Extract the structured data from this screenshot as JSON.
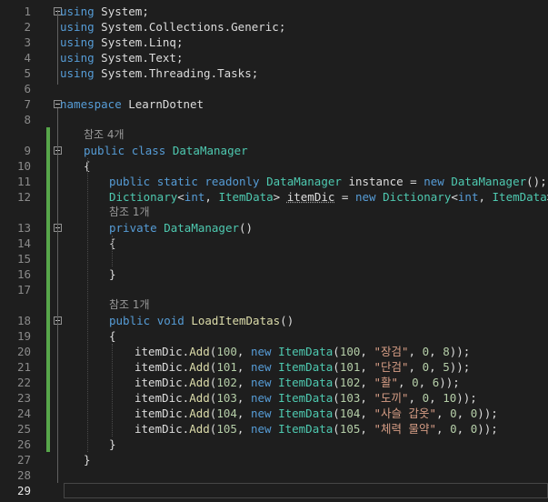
{
  "editor": {
    "current_line": 29,
    "lines": [
      {
        "num": "1",
        "indent": 0,
        "fold": true,
        "tokens": [
          {
            "c": "k",
            "t": "using"
          },
          {
            "c": "p",
            "t": " System;"
          }
        ]
      },
      {
        "num": "2",
        "indent": 0,
        "tokens": [
          {
            "c": "k",
            "t": "using"
          },
          {
            "c": "p",
            "t": " System.Collections.Generic;"
          }
        ]
      },
      {
        "num": "3",
        "indent": 0,
        "tokens": [
          {
            "c": "k",
            "t": "using"
          },
          {
            "c": "p",
            "t": " System.Linq;"
          }
        ]
      },
      {
        "num": "4",
        "indent": 0,
        "tokens": [
          {
            "c": "k",
            "t": "using"
          },
          {
            "c": "p",
            "t": " System.Text;"
          }
        ]
      },
      {
        "num": "5",
        "indent": 0,
        "tokens": [
          {
            "c": "k",
            "t": "using"
          },
          {
            "c": "p",
            "t": " System.Threading.Tasks;"
          }
        ]
      },
      {
        "num": "6",
        "indent": 0,
        "tokens": []
      },
      {
        "num": "7",
        "indent": 0,
        "fold": true,
        "tokens": [
          {
            "c": "k",
            "t": "namespace"
          },
          {
            "c": "p",
            "t": " LearnDotnet"
          }
        ]
      },
      {
        "num": "8",
        "indent": 0,
        "tokens": []
      },
      {
        "lens": "참조 4개",
        "indent": 1
      },
      {
        "num": "9",
        "indent": 1,
        "fold": true,
        "tokens": [
          {
            "c": "k",
            "t": "public"
          },
          {
            "c": "p",
            "t": " "
          },
          {
            "c": "k",
            "t": "class"
          },
          {
            "c": "p",
            "t": " "
          },
          {
            "c": "t",
            "t": "DataManager"
          }
        ]
      },
      {
        "num": "10",
        "indent": 1,
        "tokens": [
          {
            "c": "p",
            "t": "{"
          }
        ]
      },
      {
        "num": "11",
        "indent": 2,
        "tokens": [
          {
            "c": "k",
            "t": "public"
          },
          {
            "c": "p",
            "t": " "
          },
          {
            "c": "k",
            "t": "static"
          },
          {
            "c": "p",
            "t": " "
          },
          {
            "c": "k",
            "t": "readonly"
          },
          {
            "c": "p",
            "t": " "
          },
          {
            "c": "t",
            "t": "DataManager"
          },
          {
            "c": "p",
            "t": " instance = "
          },
          {
            "c": "k",
            "t": "new"
          },
          {
            "c": "p",
            "t": " "
          },
          {
            "c": "t",
            "t": "DataManager"
          },
          {
            "c": "p",
            "t": "();"
          }
        ]
      },
      {
        "num": "12",
        "indent": 2,
        "tokens": [
          {
            "c": "t",
            "t": "Dictionary"
          },
          {
            "c": "p",
            "t": "<"
          },
          {
            "c": "k",
            "t": "int"
          },
          {
            "c": "p",
            "t": ", "
          },
          {
            "c": "t",
            "t": "ItemData"
          },
          {
            "c": "p",
            "t": "> "
          },
          {
            "c": "v squiggle",
            "t": "itemDic"
          },
          {
            "c": "p",
            "t": " = "
          },
          {
            "c": "k",
            "t": "new"
          },
          {
            "c": "p",
            "t": " "
          },
          {
            "c": "t",
            "t": "Dictionary"
          },
          {
            "c": "p",
            "t": "<"
          },
          {
            "c": "k",
            "t": "int"
          },
          {
            "c": "p",
            "t": ", "
          },
          {
            "c": "t",
            "t": "ItemData"
          },
          {
            "c": "p",
            "t": ">();"
          }
        ]
      },
      {
        "lens": "참조 1개",
        "indent": 2
      },
      {
        "num": "13",
        "indent": 2,
        "fold": true,
        "tokens": [
          {
            "c": "k",
            "t": "private"
          },
          {
            "c": "p",
            "t": " "
          },
          {
            "c": "t",
            "t": "DataManager"
          },
          {
            "c": "p",
            "t": "()"
          }
        ]
      },
      {
        "num": "14",
        "indent": 2,
        "tokens": [
          {
            "c": "p",
            "t": "{"
          }
        ]
      },
      {
        "num": "15",
        "indent": 2,
        "tokens": []
      },
      {
        "num": "16",
        "indent": 2,
        "tokens": [
          {
            "c": "p",
            "t": "}"
          }
        ]
      },
      {
        "num": "17",
        "indent": 2,
        "tokens": []
      },
      {
        "lens": "참조 1개",
        "indent": 2
      },
      {
        "num": "18",
        "indent": 2,
        "fold": true,
        "tokens": [
          {
            "c": "k",
            "t": "public"
          },
          {
            "c": "p",
            "t": " "
          },
          {
            "c": "k",
            "t": "void"
          },
          {
            "c": "p",
            "t": " "
          },
          {
            "c": "m",
            "t": "LoadItemDatas"
          },
          {
            "c": "p",
            "t": "()"
          }
        ]
      },
      {
        "num": "19",
        "indent": 2,
        "tokens": [
          {
            "c": "p",
            "t": "{"
          }
        ]
      },
      {
        "num": "20",
        "indent": 3,
        "tokens": [
          {
            "c": "p",
            "t": "itemDic."
          },
          {
            "c": "m",
            "t": "Add"
          },
          {
            "c": "p",
            "t": "("
          },
          {
            "c": "n",
            "t": "100"
          },
          {
            "c": "p",
            "t": ", "
          },
          {
            "c": "k",
            "t": "new"
          },
          {
            "c": "p",
            "t": " "
          },
          {
            "c": "t",
            "t": "ItemData"
          },
          {
            "c": "p",
            "t": "("
          },
          {
            "c": "n",
            "t": "100"
          },
          {
            "c": "p",
            "t": ", "
          },
          {
            "c": "s",
            "t": "\"장검\""
          },
          {
            "c": "p",
            "t": ", "
          },
          {
            "c": "n",
            "t": "0"
          },
          {
            "c": "p",
            "t": ", "
          },
          {
            "c": "n",
            "t": "8"
          },
          {
            "c": "p",
            "t": "));"
          }
        ]
      },
      {
        "num": "21",
        "indent": 3,
        "tokens": [
          {
            "c": "p",
            "t": "itemDic."
          },
          {
            "c": "m",
            "t": "Add"
          },
          {
            "c": "p",
            "t": "("
          },
          {
            "c": "n",
            "t": "101"
          },
          {
            "c": "p",
            "t": ", "
          },
          {
            "c": "k",
            "t": "new"
          },
          {
            "c": "p",
            "t": " "
          },
          {
            "c": "t",
            "t": "ItemData"
          },
          {
            "c": "p",
            "t": "("
          },
          {
            "c": "n",
            "t": "101"
          },
          {
            "c": "p",
            "t": ", "
          },
          {
            "c": "s",
            "t": "\"단검\""
          },
          {
            "c": "p",
            "t": ", "
          },
          {
            "c": "n",
            "t": "0"
          },
          {
            "c": "p",
            "t": ", "
          },
          {
            "c": "n",
            "t": "5"
          },
          {
            "c": "p",
            "t": "));"
          }
        ]
      },
      {
        "num": "22",
        "indent": 3,
        "tokens": [
          {
            "c": "p",
            "t": "itemDic."
          },
          {
            "c": "m",
            "t": "Add"
          },
          {
            "c": "p",
            "t": "("
          },
          {
            "c": "n",
            "t": "102"
          },
          {
            "c": "p",
            "t": ", "
          },
          {
            "c": "k",
            "t": "new"
          },
          {
            "c": "p",
            "t": " "
          },
          {
            "c": "t",
            "t": "ItemData"
          },
          {
            "c": "p",
            "t": "("
          },
          {
            "c": "n",
            "t": "102"
          },
          {
            "c": "p",
            "t": ", "
          },
          {
            "c": "s",
            "t": "\"활\""
          },
          {
            "c": "p",
            "t": ", "
          },
          {
            "c": "n",
            "t": "0"
          },
          {
            "c": "p",
            "t": ", "
          },
          {
            "c": "n",
            "t": "6"
          },
          {
            "c": "p",
            "t": "));"
          }
        ]
      },
      {
        "num": "23",
        "indent": 3,
        "tokens": [
          {
            "c": "p",
            "t": "itemDic."
          },
          {
            "c": "m",
            "t": "Add"
          },
          {
            "c": "p",
            "t": "("
          },
          {
            "c": "n",
            "t": "103"
          },
          {
            "c": "p",
            "t": ", "
          },
          {
            "c": "k",
            "t": "new"
          },
          {
            "c": "p",
            "t": " "
          },
          {
            "c": "t",
            "t": "ItemData"
          },
          {
            "c": "p",
            "t": "("
          },
          {
            "c": "n",
            "t": "103"
          },
          {
            "c": "p",
            "t": ", "
          },
          {
            "c": "s",
            "t": "\"도끼\""
          },
          {
            "c": "p",
            "t": ", "
          },
          {
            "c": "n",
            "t": "0"
          },
          {
            "c": "p",
            "t": ", "
          },
          {
            "c": "n",
            "t": "10"
          },
          {
            "c": "p",
            "t": "));"
          }
        ]
      },
      {
        "num": "24",
        "indent": 3,
        "tokens": [
          {
            "c": "p",
            "t": "itemDic."
          },
          {
            "c": "m",
            "t": "Add"
          },
          {
            "c": "p",
            "t": "("
          },
          {
            "c": "n",
            "t": "104"
          },
          {
            "c": "p",
            "t": ", "
          },
          {
            "c": "k",
            "t": "new"
          },
          {
            "c": "p",
            "t": " "
          },
          {
            "c": "t",
            "t": "ItemData"
          },
          {
            "c": "p",
            "t": "("
          },
          {
            "c": "n",
            "t": "104"
          },
          {
            "c": "p",
            "t": ", "
          },
          {
            "c": "s",
            "t": "\"사슬 갑옷\""
          },
          {
            "c": "p",
            "t": ", "
          },
          {
            "c": "n",
            "t": "0"
          },
          {
            "c": "p",
            "t": ", "
          },
          {
            "c": "n",
            "t": "0"
          },
          {
            "c": "p",
            "t": "));"
          }
        ]
      },
      {
        "num": "25",
        "indent": 3,
        "tokens": [
          {
            "c": "p",
            "t": "itemDic."
          },
          {
            "c": "m",
            "t": "Add"
          },
          {
            "c": "p",
            "t": "("
          },
          {
            "c": "n",
            "t": "105"
          },
          {
            "c": "p",
            "t": ", "
          },
          {
            "c": "k",
            "t": "new"
          },
          {
            "c": "p",
            "t": " "
          },
          {
            "c": "t",
            "t": "ItemData"
          },
          {
            "c": "p",
            "t": "("
          },
          {
            "c": "n",
            "t": "105"
          },
          {
            "c": "p",
            "t": ", "
          },
          {
            "c": "s",
            "t": "\"체력 물약\""
          },
          {
            "c": "p",
            "t": ", "
          },
          {
            "c": "n",
            "t": "0"
          },
          {
            "c": "p",
            "t": ", "
          },
          {
            "c": "n",
            "t": "0"
          },
          {
            "c": "p",
            "t": "));"
          }
        ]
      },
      {
        "num": "26",
        "indent": 2,
        "tokens": [
          {
            "c": "p",
            "t": "}"
          }
        ]
      },
      {
        "num": "27",
        "indent": 1,
        "tokens": [
          {
            "c": "p",
            "t": "}"
          }
        ]
      },
      {
        "num": "28",
        "indent": 0,
        "tokens": []
      },
      {
        "num": "29",
        "indent": 0,
        "tokens": []
      }
    ]
  },
  "colors": {
    "background": "#1e1e1e",
    "keyword": "#569cd6",
    "type": "#4ec9b0",
    "method": "#dcdcaa",
    "string": "#d69d85",
    "number": "#b5cea8",
    "change_bar": "#57a64a"
  }
}
